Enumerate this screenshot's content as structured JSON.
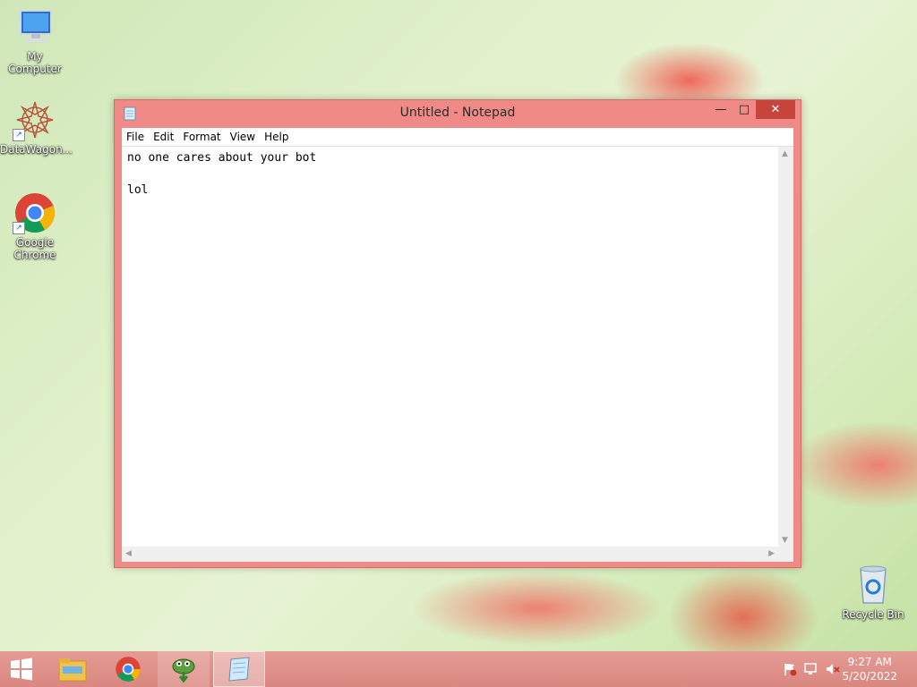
{
  "desktop": {
    "icons": [
      {
        "label": "My Computer"
      },
      {
        "label": "DataWagon..."
      },
      {
        "label": "Google Chrome"
      },
      {
        "label": "Recycle Bin"
      }
    ]
  },
  "notepad": {
    "title": "Untitled - Notepad",
    "menu": [
      "File",
      "Edit",
      "Format",
      "View",
      "Help"
    ],
    "content": "no one cares about your bot\n\nlol",
    "window_buttons": {
      "minimize": "—",
      "maximize": "□",
      "close": "✕"
    }
  },
  "taskbar": {
    "items": [
      "start-button",
      "file-explorer",
      "google-chrome",
      "pinned-app",
      "notepad"
    ],
    "time": "9:27 AM",
    "date": "5/20/2022",
    "tray_icons": [
      "action-center-flag-icon",
      "network-icon",
      "volume-muted-icon"
    ]
  },
  "colors": {
    "window_frame": "#ef8a86",
    "close_button": "#c7443d",
    "taskbar": "#d9877f"
  }
}
